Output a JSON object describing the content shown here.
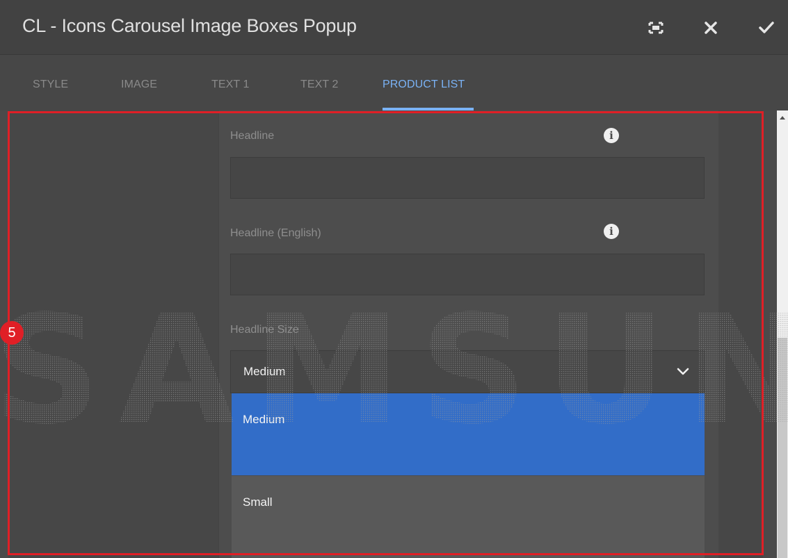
{
  "dialog": {
    "title": "CL - Icons Carousel Image Boxes Popup",
    "buttons": {
      "fullscreen_icon": "fullscreen-icon",
      "close_icon": "close-icon",
      "confirm_icon": "checkmark-icon"
    }
  },
  "tabs": [
    {
      "label": "STYLE",
      "active": false
    },
    {
      "label": "IMAGE",
      "active": false
    },
    {
      "label": "TEXT 1",
      "active": false
    },
    {
      "label": "TEXT 2",
      "active": false
    },
    {
      "label": "PRODUCT LIST",
      "active": true
    }
  ],
  "form": {
    "headline": {
      "label": "Headline",
      "value": ""
    },
    "headline_english": {
      "label": "Headline (English)",
      "value": ""
    },
    "headline_size": {
      "label": "Headline Size",
      "selected": "Medium",
      "options": [
        "Medium",
        "Small"
      ]
    }
  },
  "annotation": {
    "step": "5"
  },
  "watermark": {
    "text": "SAMSUNG"
  },
  "colors": {
    "accent": "#7ab2f5",
    "selected_option": "#326dc8",
    "highlight": "#e01f26"
  }
}
